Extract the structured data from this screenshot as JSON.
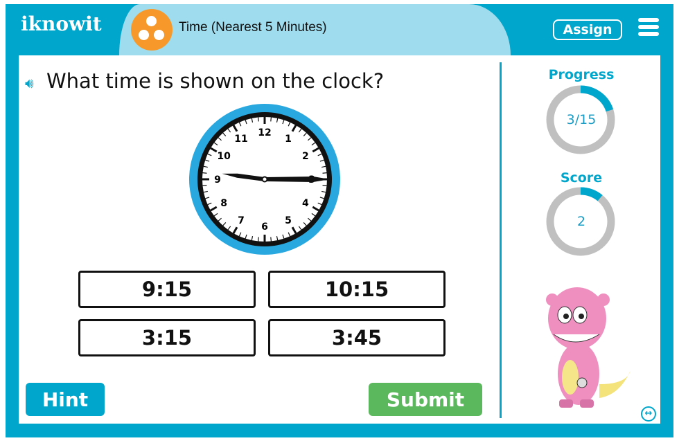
{
  "header": {
    "logo": "iknowit",
    "topic_icon": "three-dots-icon",
    "title": "Time (Nearest 5 Minutes)",
    "assign_label": "Assign",
    "menu_icon": "hamburger-icon"
  },
  "question": {
    "speaker_icon": "speaker-icon",
    "text": "What time is shown on the clock?"
  },
  "clock": {
    "numbers": [
      "12",
      "1",
      "2",
      "3",
      "4",
      "5",
      "6",
      "7",
      "8",
      "9",
      "10",
      "11"
    ],
    "hour": 9,
    "minute": 15
  },
  "answers": [
    "9:15",
    "10:15",
    "3:15",
    "3:45"
  ],
  "buttons": {
    "hint": "Hint",
    "submit": "Submit"
  },
  "progress": {
    "label": "Progress",
    "value": "3/15",
    "fraction": 0.2
  },
  "score": {
    "label": "Score",
    "value": "2",
    "fraction": 0.11
  },
  "colors": {
    "brand": "#00a6cb",
    "title_bar": "#9edcee",
    "topic": "#f7992a",
    "submit": "#5cb85c",
    "ring_bg": "#c0c0c0"
  },
  "expand_icon": "expand-arrows-icon"
}
